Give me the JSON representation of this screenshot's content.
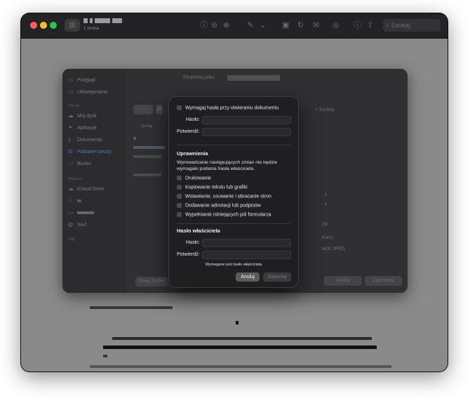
{
  "window": {
    "subtitle": "1 strona",
    "search_placeholder": "Szukaj"
  },
  "export_sheet": {
    "export_as_label": "Eksportuj jako:",
    "sidebar": {
      "items_top": [
        {
          "label": "Podgląd",
          "icon": "folder-icon"
        },
        {
          "label": "Udostępniane",
          "icon": "shared-folder-icon"
        }
      ],
      "section_cloud": "iCloud",
      "items_cloud": [
        {
          "label": "Mój dysk",
          "icon": "cloud-icon"
        },
        {
          "label": "Aplikacje",
          "icon": "apps-icon"
        },
        {
          "label": "Dokumenty",
          "icon": "document-icon"
        },
        {
          "label": "Pobrane rzeczy",
          "icon": "download-icon"
        },
        {
          "label": "Biurko",
          "icon": "desktop-icon"
        }
      ],
      "section_places": "Miejsca",
      "items_places": [
        {
          "label": "iCloud Drive",
          "icon": "cloud-icon"
        },
        {
          "label": "",
          "icon": "home-icon"
        },
        {
          "label": "",
          "icon": "computer-icon"
        },
        {
          "label": "Sieć",
          "icon": "network-icon"
        }
      ],
      "section_tags": "Tagi"
    },
    "column_header": "Dzisiaj",
    "search_placeholder": "Szukaj",
    "format_fragments": [
      "DF",
      "tranu",
      "acie JPEG"
    ],
    "new_folder_label": "Nowy folder",
    "cancel_label": "Anuluj",
    "save_label": "Zachowaj"
  },
  "password_dialog": {
    "require_open_password_label": "Wymagaj hasła przy otwieraniu dokumentu",
    "open_password_label": "Hasło:",
    "open_confirm_label": "Potwierdź:",
    "permissions_heading": "Uprawnienia",
    "permissions_description": "Wprowadzanie następujących zmian nie będzie wymagało podania hasła właściciela.",
    "permissions": [
      "Drukowanie",
      "Kopiowanie tekstu lub grafiki",
      "Wstawianie, usuwanie i obracanie stron",
      "Dodawanie adnotacji lub podpisów",
      "Wypełnianie istniejących pól formularza"
    ],
    "owner_heading": "Hasło właściciela",
    "owner_password_label": "Hasło:",
    "owner_confirm_label": "Potwierdź:",
    "owner_required_notice": "Wymagane jest hasło właściciela",
    "cancel_label": "Anuluj",
    "apply_label": "Zastosuj"
  }
}
